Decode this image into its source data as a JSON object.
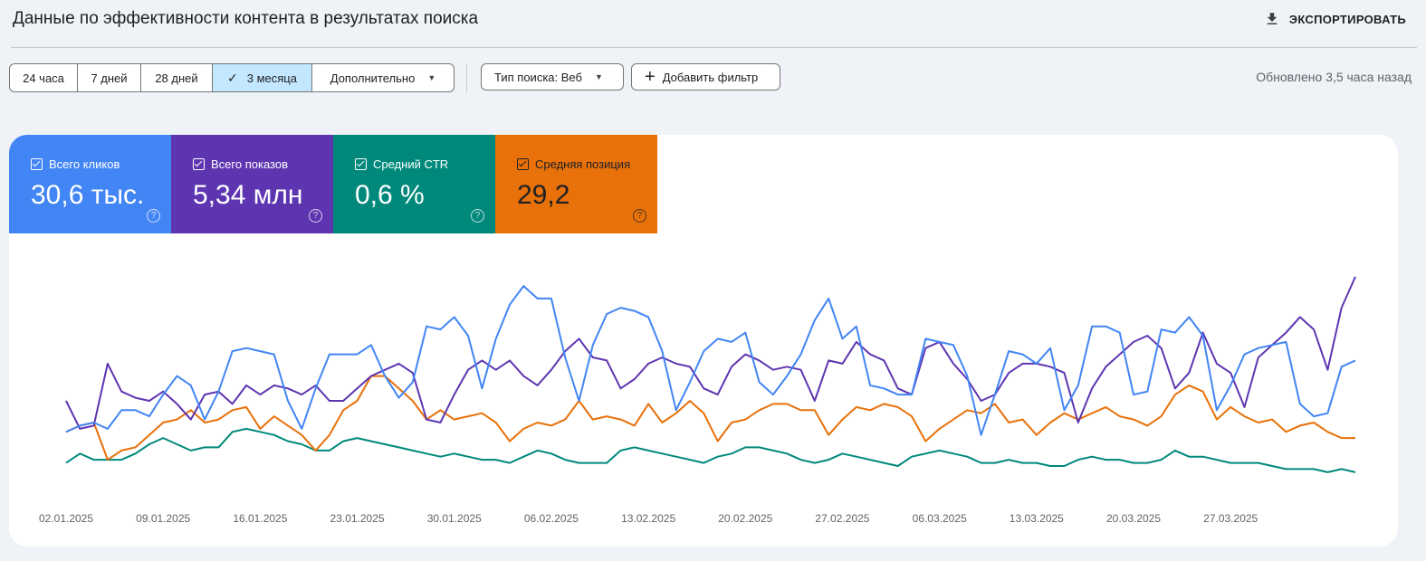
{
  "header": {
    "title": "Данные по эффективности контента в результатах поиска",
    "export_label": "ЭКСПОРТИРОВАТЬ"
  },
  "date_range": {
    "options": [
      "24 часа",
      "7 дней",
      "28 дней",
      "3 месяца"
    ],
    "active": "3 месяца",
    "more_label": "Дополнительно"
  },
  "filters": {
    "search_type_label": "Тип поиска: Веб",
    "add_filter_label": "Добавить фильтр"
  },
  "updated_label": "Обновлено 3,5 часа назад",
  "metrics": [
    {
      "label": "Всего кликов",
      "value": "30,6 тыс.",
      "color": "#4285f4",
      "checked": true
    },
    {
      "label": "Всего показов",
      "value": "5,34 млн",
      "color": "#5e35b1",
      "checked": true
    },
    {
      "label": "Средний CTR",
      "value": "0,6 %",
      "color": "#00897b",
      "checked": true
    },
    {
      "label": "Средняя позиция",
      "value": "29,2",
      "color": "#e8710a",
      "checked": true
    }
  ],
  "chart_data": {
    "type": "line",
    "x_tick_labels": [
      "02.01.2025",
      "09.01.2025",
      "16.01.2025",
      "23.01.2025",
      "30.01.2025",
      "06.02.2025",
      "13.02.2025",
      "20.02.2025",
      "27.02.2025",
      "06.03.2025",
      "13.03.2025",
      "20.03.2025",
      "27.03.2025"
    ],
    "x_start_date": "2025-01-02",
    "x_tick_every_days": 7,
    "y_axis_shown": false,
    "grid": false,
    "series": [
      {
        "name": "Всего кликов",
        "color": "#4285f4",
        "values": [
          48,
          50,
          51,
          49,
          55,
          55,
          53,
          60,
          66,
          63,
          52,
          61,
          74,
          75,
          74,
          73,
          58,
          49,
          62,
          73,
          73,
          73,
          76,
          66,
          59,
          64,
          82,
          81,
          85,
          79,
          62,
          78,
          89,
          95,
          91,
          91,
          72,
          58,
          76,
          86,
          88,
          87,
          85,
          74,
          55,
          64,
          74,
          78,
          77,
          80,
          64,
          60,
          66,
          73,
          84,
          91,
          78,
          82,
          63,
          62,
          60,
          60,
          78,
          77,
          76,
          66,
          47,
          60,
          74,
          73,
          70,
          75,
          55,
          63,
          82,
          82,
          80,
          60,
          61,
          81,
          80,
          85,
          79,
          55,
          63,
          73,
          75,
          76,
          77,
          57,
          53,
          54,
          69,
          71
        ]
      },
      {
        "name": "Всего показов",
        "color": "#5e35b1",
        "values": [
          58,
          49,
          50,
          70,
          61,
          59,
          58,
          61,
          57,
          52,
          60,
          61,
          57,
          63,
          60,
          63,
          62,
          60,
          63,
          58,
          58,
          62,
          66,
          68,
          70,
          67,
          52,
          51,
          60,
          68,
          71,
          68,
          71,
          66,
          63,
          68,
          74,
          78,
          72,
          71,
          62,
          65,
          70,
          72,
          70,
          69,
          62,
          60,
          69,
          73,
          71,
          68,
          69,
          68,
          58,
          71,
          70,
          77,
          73,
          71,
          62,
          60,
          75,
          77,
          70,
          65,
          58,
          60,
          67,
          70,
          70,
          69,
          67,
          51,
          62,
          69,
          73,
          77,
          79,
          75,
          62,
          67,
          80,
          70,
          67,
          56,
          72,
          76,
          80,
          85,
          81,
          68,
          88,
          98
        ]
      },
      {
        "name": "Средний CTR",
        "color": "#e8710a",
        "values": [
          48,
          50,
          51,
          39,
          42,
          43,
          47,
          51,
          52,
          55,
          51,
          52,
          55,
          56,
          49,
          53,
          50,
          47,
          42,
          47,
          55,
          58,
          66,
          66,
          62,
          58,
          52,
          55,
          52,
          53,
          54,
          51,
          45,
          49,
          51,
          50,
          52,
          58,
          52,
          53,
          52,
          50,
          57,
          51,
          54,
          58,
          54,
          45,
          51,
          52,
          55,
          57,
          57,
          55,
          55,
          47,
          52,
          56,
          55,
          57,
          56,
          53,
          45,
          49,
          52,
          55,
          54,
          57,
          51,
          52,
          47,
          51,
          54,
          52,
          54,
          56,
          53,
          52,
          50,
          53,
          60,
          63,
          61,
          52,
          56,
          53,
          51,
          52,
          48,
          50,
          51,
          48,
          46,
          46
        ]
      },
      {
        "name": "Средняя позиция",
        "color": "#00897b",
        "values": [
          38,
          41,
          39,
          39,
          39,
          41,
          44,
          46,
          44,
          42,
          43,
          43,
          48,
          49,
          48,
          47,
          45,
          44,
          42,
          42,
          45,
          46,
          45,
          44,
          43,
          42,
          41,
          40,
          41,
          40,
          39,
          39,
          38,
          40,
          42,
          41,
          39,
          38,
          38,
          38,
          42,
          43,
          42,
          41,
          40,
          39,
          38,
          40,
          41,
          43,
          43,
          42,
          41,
          39,
          38,
          39,
          41,
          40,
          39,
          38,
          37,
          40,
          41,
          42,
          41,
          40,
          38,
          38,
          39,
          38,
          38,
          37,
          37,
          39,
          40,
          39,
          39,
          38,
          38,
          39,
          42,
          40,
          40,
          39,
          38,
          38,
          38,
          37,
          36,
          36,
          36,
          35,
          36,
          35
        ]
      }
    ]
  }
}
